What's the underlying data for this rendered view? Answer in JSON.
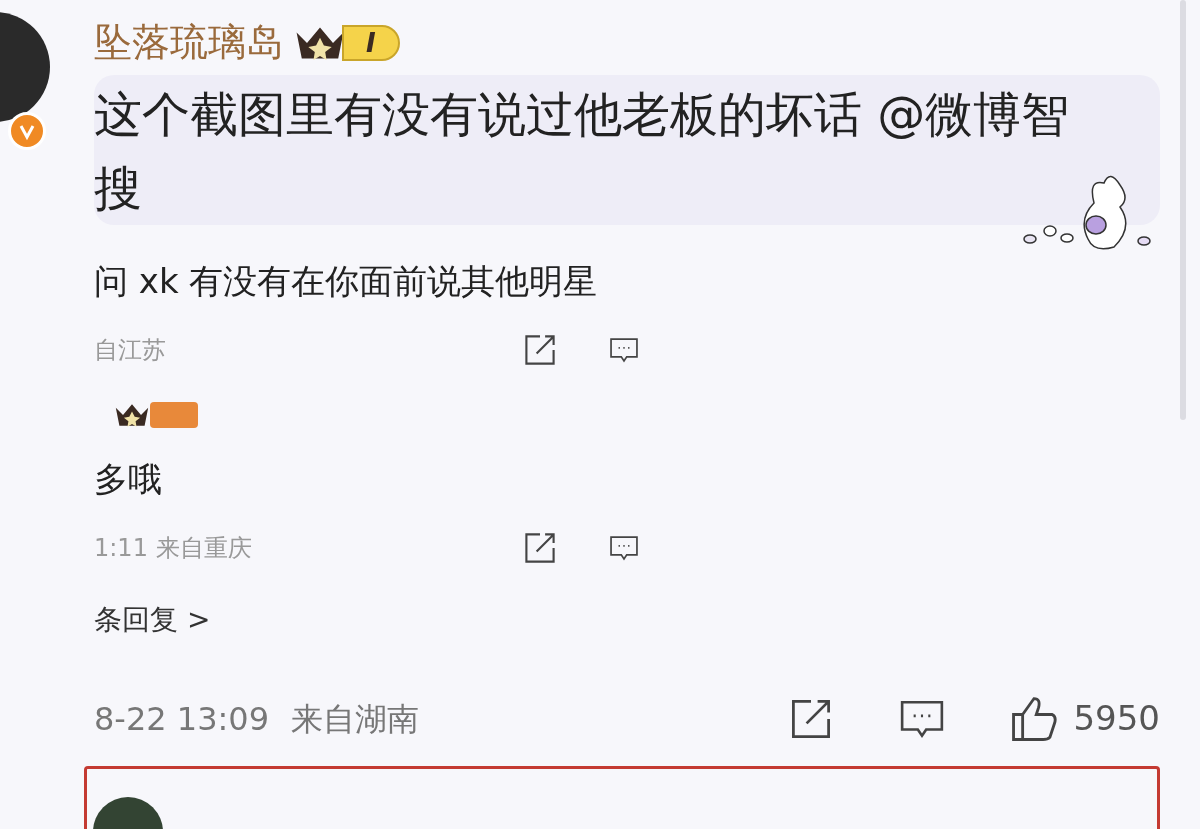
{
  "comment": {
    "author": "坠落琉璃岛",
    "level_badge": "I",
    "verified": true,
    "text": "这个截图里有没有说过他老板的坏话 @微博智搜"
  },
  "screenshot": {
    "lines": [
      {
        "kind": "text",
        "text": "问 xk 有没有在你面前说其他明星"
      },
      {
        "kind": "meta",
        "text": "自江苏"
      },
      {
        "kind": "badge"
      },
      {
        "kind": "text",
        "text": "多哦"
      },
      {
        "kind": "meta",
        "text": "1:11 来自重庆"
      },
      {
        "kind": "link",
        "text": "条回复 >"
      }
    ]
  },
  "footer": {
    "time": "8-22 13:09",
    "location": "来自湖南",
    "likes": "5950"
  },
  "next_comment": {
    "highlighted": true
  }
}
